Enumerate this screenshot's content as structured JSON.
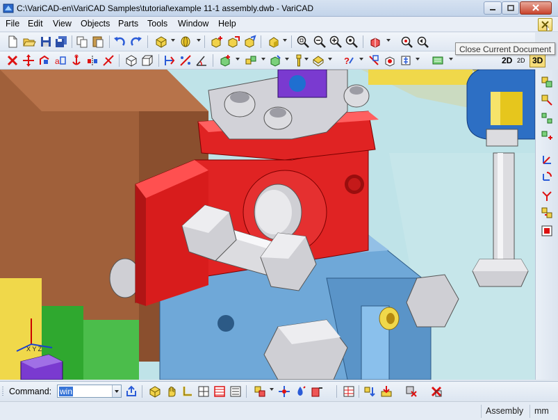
{
  "window": {
    "title": "C:\\VariCAD-en\\VariCAD Samples\\tutorial\\example 11-1 assembly.dwb - VariCAD"
  },
  "menu": {
    "items": [
      "File",
      "Edit",
      "View",
      "Objects",
      "Parts",
      "Tools",
      "Window",
      "Help"
    ]
  },
  "toolbar": {
    "view_2d": "2D",
    "view_2d_alt": "2D",
    "view_3d": "3D"
  },
  "tooltip": {
    "text": "Close Current Document"
  },
  "command": {
    "label": "Command:",
    "value": "win"
  },
  "status": {
    "mode": "Assembly",
    "units": "mm"
  },
  "colors": {
    "viewport_bg": "#bfe3e8",
    "red_part": "#e02323",
    "blue_part": "#6fa8d8",
    "brown_beam": "#a0603a",
    "metal": "#d9d9de",
    "yellow_part": "#f0d84a",
    "purple_part": "#7a3ad0",
    "green_part": "#2fa82f"
  }
}
